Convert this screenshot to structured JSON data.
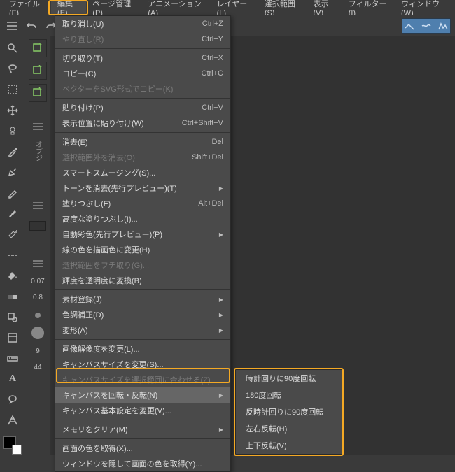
{
  "menubar": {
    "items": [
      {
        "label": "ファイル(F)"
      },
      {
        "label": "編集(E)",
        "active": true
      },
      {
        "label": "ページ管理(P)"
      },
      {
        "label": "アニメーション(A)"
      },
      {
        "label": "レイヤー(L)"
      },
      {
        "label": "選択範囲(S)"
      },
      {
        "label": "表示(V)"
      },
      {
        "label": "フィルター(I)"
      },
      {
        "label": "ウィンドウ(W)"
      }
    ]
  },
  "dropdown": {
    "groups": [
      [
        {
          "label": "取り消し(U)",
          "shortcut": "Ctrl+Z"
        },
        {
          "label": "やり直し(R)",
          "shortcut": "Ctrl+Y",
          "disabled": true
        }
      ],
      [
        {
          "label": "切り取り(T)",
          "shortcut": "Ctrl+X"
        },
        {
          "label": "コピー(C)",
          "shortcut": "Ctrl+C"
        },
        {
          "label": "ベクターをSVG形式でコピー(K)",
          "disabled": true
        }
      ],
      [
        {
          "label": "貼り付け(P)",
          "shortcut": "Ctrl+V"
        },
        {
          "label": "表示位置に貼り付け(W)",
          "shortcut": "Ctrl+Shift+V"
        }
      ],
      [
        {
          "label": "消去(E)",
          "shortcut": "Del"
        },
        {
          "label": "選択範囲外を消去(O)",
          "shortcut": "Shift+Del",
          "disabled": true
        },
        {
          "label": "スマートスムージング(S)..."
        },
        {
          "label": "トーンを消去(先行プレビュー)(T)",
          "submenu": true
        },
        {
          "label": "塗りつぶし(F)",
          "shortcut": "Alt+Del"
        },
        {
          "label": "高度な塗りつぶし(I)..."
        },
        {
          "label": "自動彩色(先行プレビュー)(P)",
          "submenu": true
        },
        {
          "label": "線の色を描画色に変更(H)"
        },
        {
          "label": "選択範囲をフチ取り(G)...",
          "disabled": true
        },
        {
          "label": "輝度を透明度に変換(B)"
        }
      ],
      [
        {
          "label": "素材登録(J)",
          "submenu": true
        },
        {
          "label": "色調補正(D)",
          "submenu": true
        },
        {
          "label": "変形(A)",
          "submenu": true
        }
      ],
      [
        {
          "label": "画像解像度を変更(L)..."
        },
        {
          "label": "キャンバスサイズを変更(S)..."
        },
        {
          "label": "キャンバスサイズを選択範囲に合わせる(Z)",
          "disabled": true
        },
        {
          "label": "キャンバスを回転・反転(N)",
          "submenu": true,
          "active": true
        },
        {
          "label": "キャンバス基本設定を変更(V)..."
        }
      ],
      [
        {
          "label": "メモリをクリア(M)",
          "submenu": true
        }
      ],
      [
        {
          "label": "画面の色を取得(X)..."
        },
        {
          "label": "ウィンドウを隠して画面の色を取得(Y)..."
        }
      ]
    ]
  },
  "submenu": {
    "items": [
      {
        "label": "時計回りに90度回転"
      },
      {
        "label": "180度回転"
      },
      {
        "label": "反時計回りに90度回転"
      },
      {
        "label": "左右反転(H)"
      },
      {
        "label": "上下反転(V)"
      }
    ]
  },
  "sidebar": {
    "numbers": [
      "0.07",
      "0.8",
      "9",
      "44"
    ],
    "label": "オブジ"
  }
}
